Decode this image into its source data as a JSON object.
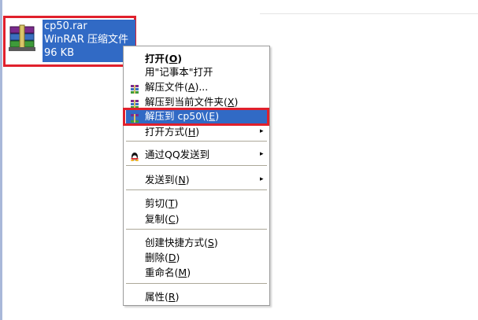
{
  "file": {
    "name": "cp50.rar",
    "type": "WinRAR 压缩文件",
    "size": "96 KB",
    "icon": "winrar-archive-icon"
  },
  "menu": {
    "items": [
      {
        "pre": "打开(",
        "acc": "O",
        "post": ")",
        "icon": null,
        "submenu": false,
        "bold": true
      },
      {
        "pre": "用\"记事本\"打开",
        "acc": "",
        "post": "",
        "icon": null,
        "submenu": false
      },
      {
        "pre": "解压文件(",
        "acc": "A",
        "post": ")...",
        "icon": "winrar-icon",
        "submenu": false
      },
      {
        "pre": "解压到当前文件夹(",
        "acc": "X",
        "post": ")",
        "icon": "winrar-icon",
        "submenu": false
      },
      {
        "pre": "解压到 cp50\\(",
        "acc": "E",
        "post": ")",
        "icon": "winrar-icon",
        "submenu": false,
        "highlighted": true
      },
      {
        "pre": "打开方式(",
        "acc": "H",
        "post": ")",
        "icon": null,
        "submenu": true
      },
      {
        "pre": "通过QQ发送到",
        "acc": "",
        "post": "",
        "icon": "qq-icon",
        "submenu": true
      },
      {
        "pre": "发送到(",
        "acc": "N",
        "post": ")",
        "icon": null,
        "submenu": true
      },
      {
        "pre": "剪切(",
        "acc": "T",
        "post": ")",
        "icon": null,
        "submenu": false
      },
      {
        "pre": "复制(",
        "acc": "C",
        "post": ")",
        "icon": null,
        "submenu": false
      },
      {
        "pre": "创建快捷方式(",
        "acc": "S",
        "post": ")",
        "icon": null,
        "submenu": false
      },
      {
        "pre": "删除(",
        "acc": "D",
        "post": ")",
        "icon": null,
        "submenu": false
      },
      {
        "pre": "重命名(",
        "acc": "M",
        "post": ")",
        "icon": null,
        "submenu": false
      },
      {
        "pre": "属性(",
        "acc": "R",
        "post": ")",
        "icon": null,
        "submenu": false
      }
    ]
  },
  "colors": {
    "selection": "#316ac5",
    "annotation_border": "#e0202c"
  }
}
